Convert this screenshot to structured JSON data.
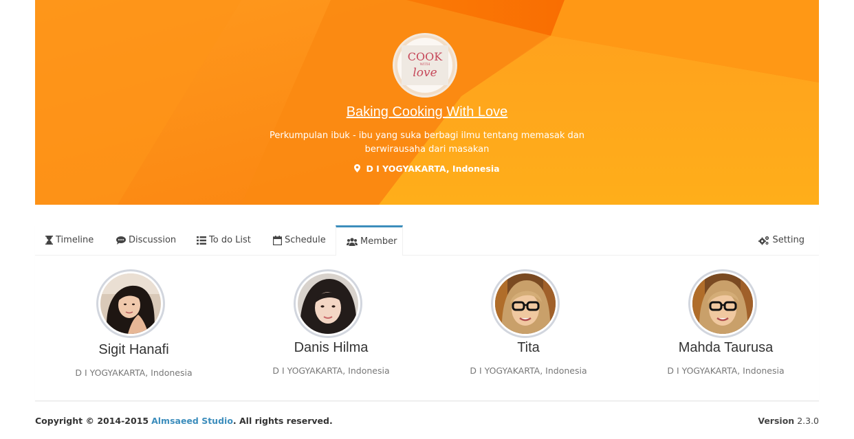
{
  "group": {
    "logo_text": {
      "line1": "COOK",
      "line2": "WITH",
      "line3": "love"
    },
    "title": "Baking Cooking With Love",
    "description": "Perkumpulan ibuk - ibu yang suka berbagi ilmu tentang memasak dan berwirausaha dari masakan",
    "location": "D I YOGYAKARTA, Indonesia"
  },
  "tabs": {
    "timeline": "Timeline",
    "discussion": "Discussion",
    "todo": "To do List",
    "schedule": "Schedule",
    "member": "Member",
    "setting": "Setting",
    "active": "member"
  },
  "members": [
    {
      "name": "Sigit Hanafi",
      "location": "D I YOGYAKARTA, Indonesia"
    },
    {
      "name": "Danis Hilma",
      "location": "D I YOGYAKARTA, Indonesia"
    },
    {
      "name": "Tita",
      "location": "D I YOGYAKARTA, Indonesia"
    },
    {
      "name": "Mahda Taurusa",
      "location": "D I YOGYAKARTA, Indonesia"
    }
  ],
  "footer": {
    "copyright_prefix": "Copyright © 2014-2015",
    "brand": "Almsaeed Studio",
    "suffix": ". All rights reserved.",
    "version_label": "Version",
    "version_value": "2.3.0"
  },
  "colors": {
    "hero_orange": "#fb8c10",
    "accent_blue": "#3c8dbc",
    "avatar_border": "#d2d6de"
  }
}
